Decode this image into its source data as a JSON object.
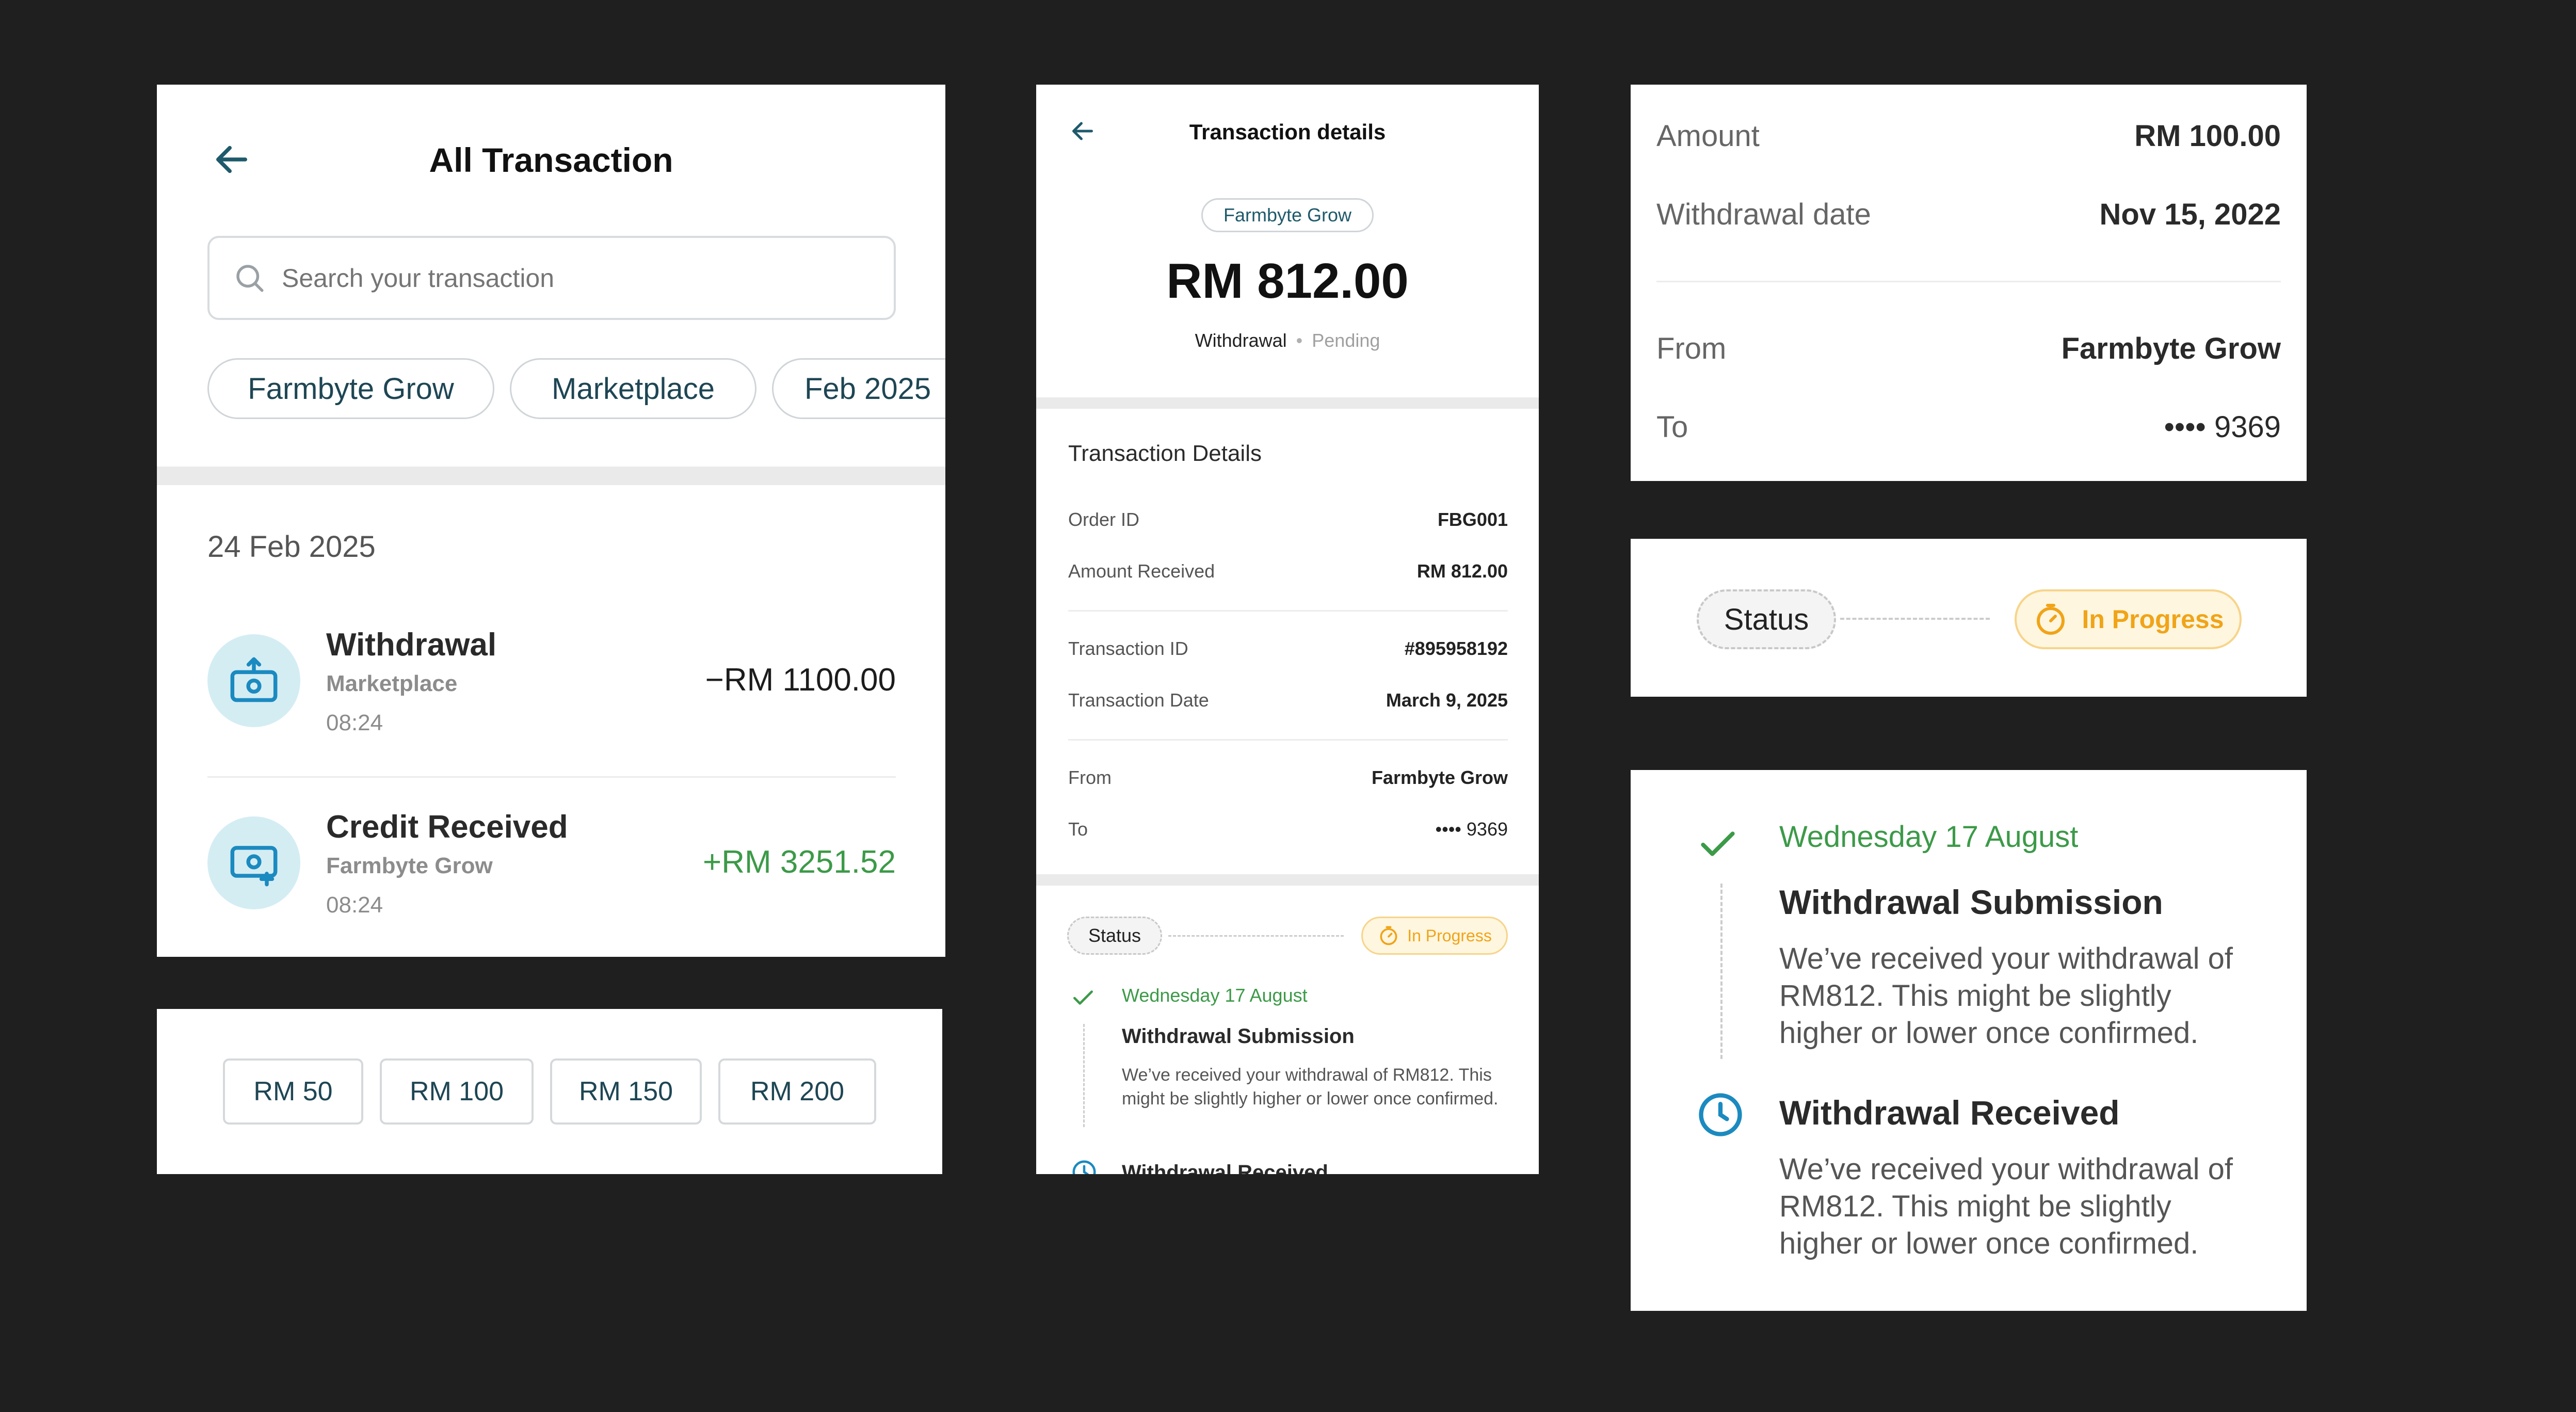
{
  "list": {
    "title": "All Transaction",
    "search_placeholder": "Search your transaction",
    "filters": [
      "Farmbyte Grow",
      "Marketplace",
      "Feb 2025"
    ],
    "date_header": "24 Feb 2025",
    "items": [
      {
        "title": "Withdrawal",
        "source": "Marketplace",
        "time": "08:24",
        "amount": "−RM 1100.00",
        "icon": "money-out-icon",
        "amount_color": "#1c1c1c"
      },
      {
        "title": "Credit Received",
        "source": "Farmbyte Grow",
        "time": "08:24",
        "amount": "+RM 3251.52",
        "icon": "money-in-icon",
        "amount_color": "#3c9a48"
      }
    ]
  },
  "quick_amounts": [
    "RM 50",
    "RM 100",
    "RM 150",
    "RM 200"
  ],
  "details": {
    "header_title": "Transaction details",
    "badge": "Farmbyte Grow",
    "amount": "RM 812.00",
    "type": "Withdrawal",
    "separator": "•",
    "status_text": "Pending",
    "section_title": "Transaction Details",
    "rows": [
      {
        "label": "Order ID",
        "value": "FBG001"
      },
      {
        "label": "Amount Received",
        "value": "RM 812.00"
      },
      {
        "label": "Transaction ID",
        "value": "#895958192"
      },
      {
        "label": "Transaction Date",
        "value": "March 9, 2025"
      },
      {
        "label": "From",
        "value": "Farmbyte Grow"
      },
      {
        "label": "To",
        "value": "••••  9369"
      }
    ],
    "status_label": "Status",
    "status_value": "In Progress",
    "timeline_date": "Wednesday 17 August",
    "timeline_title": "Withdrawal Submission",
    "timeline_desc": "We’ve received your withdrawal of RM812. This might be slightly higher or lower once confirmed.",
    "timeline_next_title": "Withdrawal Received"
  },
  "summary": {
    "rows": [
      {
        "label": "Amount",
        "value": "RM 100.00"
      },
      {
        "label": "Withdrawal date",
        "value": "Nov 15, 2022"
      },
      {
        "label": "From",
        "value": "Farmbyte Grow"
      },
      {
        "label": "To",
        "value": "••••  9369"
      }
    ]
  },
  "status_card": {
    "label": "Status",
    "value": "In Progress"
  },
  "timeline_card": {
    "date": "Wednesday 17 August",
    "step1_title": "Withdrawal Submission",
    "step1_desc": "We’ve received your withdrawal of RM812. This might be slightly higher or lower once confirmed.",
    "step2_title": "Withdrawal Received",
    "step2_desc": "We’ve received your withdrawal of RM812. This might be slightly higher or lower once confirmed."
  },
  "colors": {
    "background": "#1f1f1f",
    "teal": "#1e5a6b",
    "green": "#3c9a48",
    "orange": "#f0a418",
    "orange_bg": "#fff6df",
    "icon_circle": "#d4edf3",
    "icon_blue": "#1b8ac0"
  }
}
